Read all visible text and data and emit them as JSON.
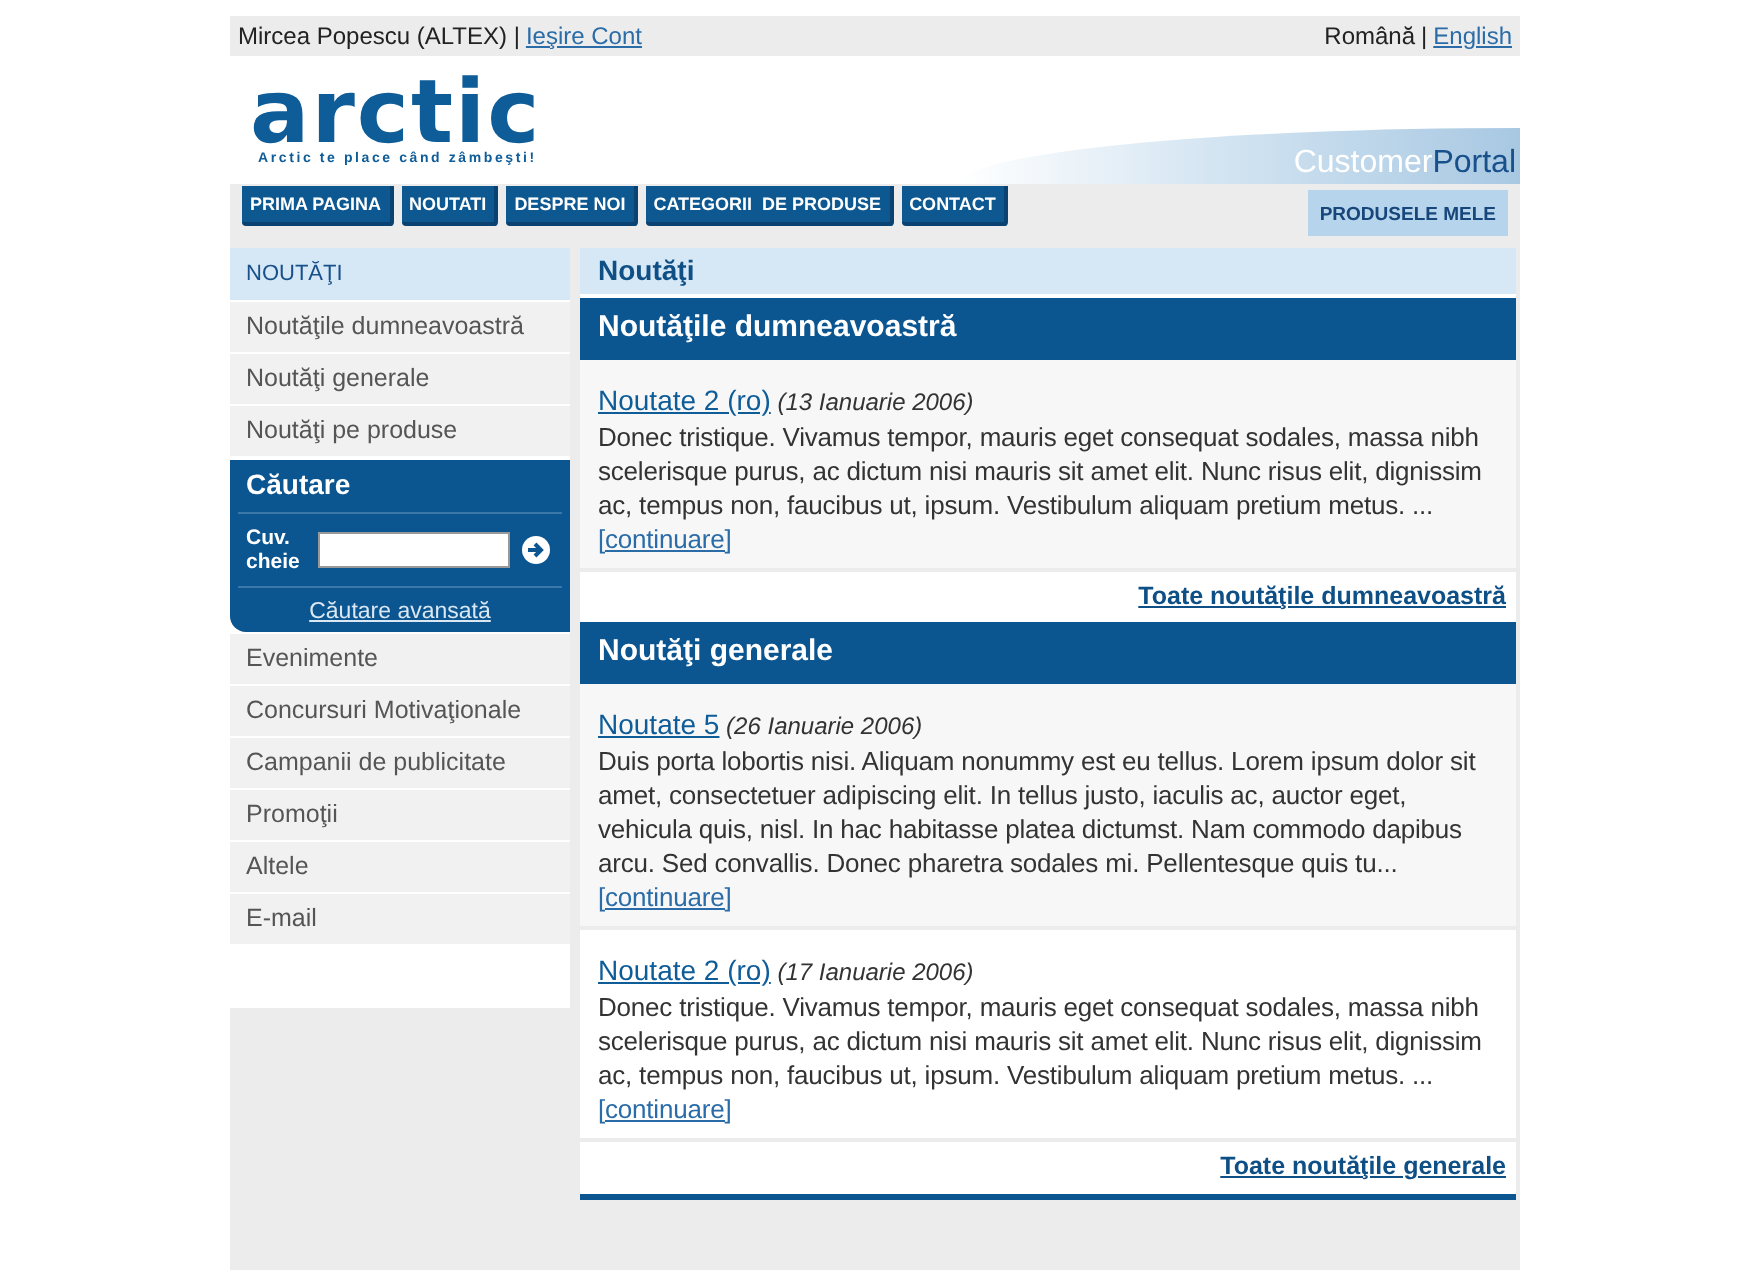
{
  "top_bar": {
    "user": "Mircea Popescu (ALTEX) |",
    "logout_link": "Ieşire Cont",
    "language_separator": "|",
    "languages": [
      {
        "label": "Română",
        "selected": true
      },
      {
        "label": "English",
        "selected": false
      }
    ]
  },
  "header": {
    "logo": "arctic",
    "tagline": "Arctic te place când zâmbeşti!",
    "portal_label": {
      "part_1": "Customer",
      "part_2": "Portal"
    }
  },
  "nav": {
    "items": [
      {
        "label": "PRIMA PAGINA"
      },
      {
        "label": "NOUTATI"
      },
      {
        "label": "DESPRE NOI"
      },
      {
        "label": "CATEGORII  DE PRODUSE"
      },
      {
        "label": "CONTACT"
      }
    ],
    "right_button": "PRODUSELE MELE"
  },
  "sidebar": {
    "heading": "NOUTĂŢI",
    "items": [
      {
        "label": "Noutăţile dumneavoastră"
      },
      {
        "label": "Noutăţi generale"
      },
      {
        "label": "Noutăţi pe produse"
      }
    ],
    "search": {
      "title": "Căutare",
      "field_label": "Cuv. cheie",
      "advanced_link": "Căutare avansată"
    },
    "more_items": [
      {
        "label": "Evenimente"
      },
      {
        "label": "Concursuri Motivaţionale"
      },
      {
        "label": "Campanii de publicitate"
      },
      {
        "label": "Promoţii"
      },
      {
        "label": "Altele"
      },
      {
        "label": "E-mail"
      }
    ]
  },
  "content": {
    "title": "Noutăţi",
    "sections": [
      {
        "title": "Noutăţile dumneavoastră",
        "articles": [
          {
            "title": "Noutate 2 (ro)",
            "date": "(13 Ianuarie 2006)",
            "text": "Donec tristique. Vivamus tempor, mauris eget consequat sodales, massa nibh scelerisque purus, ac dictum nisi mauris sit amet elit. Nunc risus elit, dignissim ac, tempus non, faucibus ut, ipsum. Vestibulum aliquam pretium metus. ...",
            "more": "[continuare]"
          }
        ],
        "footer_link": "Toate noutăţile dumneavoastră"
      },
      {
        "title": "Noutăţi generale",
        "articles": [
          {
            "title": "Noutate 5",
            "date": "(26 Ianuarie 2006)",
            "text": "Duis porta lobortis nisi. Aliquam nonummy est eu tellus. Lorem ipsum dolor sit amet, consectetuer adipiscing elit. In tellus justo, iaculis ac, auctor eget, vehicula quis, nisl. In hac habitasse platea dictumst. Nam commodo dapibus arcu. Sed convallis. Donec pharetra sodales mi. Pellentesque quis tu...",
            "more": "[continuare]"
          },
          {
            "title": "Noutate 2 (ro)",
            "date": "(17 Ianuarie 2006)",
            "text": "Donec tristique. Vivamus tempor, mauris eget consequat sodales, massa nibh scelerisque purus, ac dictum nisi mauris sit amet elit. Nunc risus elit, dignissim ac, tempus non, faucibus ut, ipsum. Vestibulum aliquam pretium metus. ...",
            "more": "[continuare]"
          }
        ],
        "footer_link": "Toate noutăţile generale"
      }
    ]
  }
}
